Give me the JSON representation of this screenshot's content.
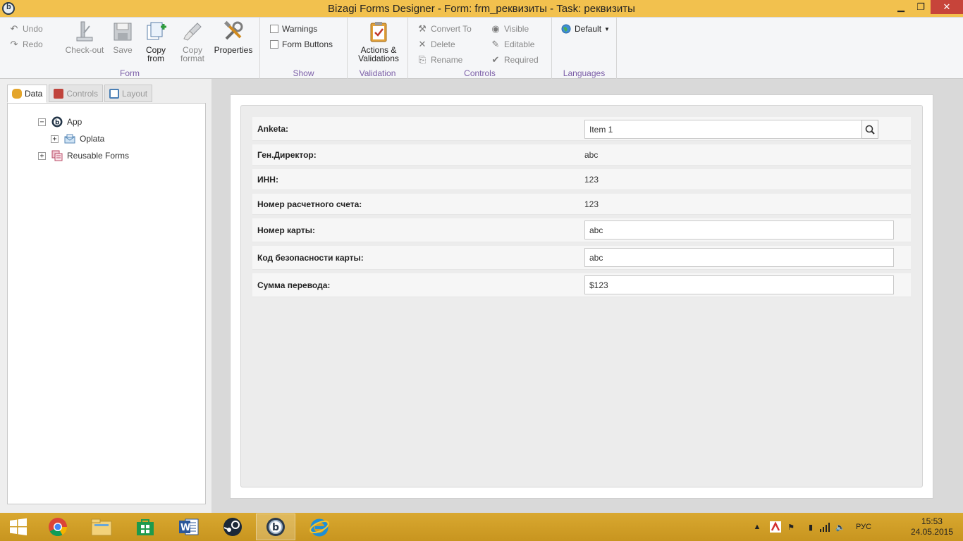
{
  "window": {
    "title": "Bizagi Forms Designer  - Form: frm_реквизиты - Task:  реквизиты",
    "minimize": "▁",
    "maximize": "❐",
    "close": "✕"
  },
  "ribbon": {
    "form_group": {
      "label": "Form",
      "undo": "Undo",
      "redo": "Redo",
      "checkout": "Check-out",
      "save": "Save",
      "copy_from": "Copy from",
      "copy_format": "Copy format",
      "properties": "Properties"
    },
    "show_group": {
      "label": "Show",
      "warnings": "Warnings",
      "form_buttons": "Form Buttons"
    },
    "validation_group": {
      "label": "Validation",
      "actions": "Actions & Validations"
    },
    "controls_group": {
      "label": "Controls",
      "convert_to": "Convert To",
      "delete": "Delete",
      "rename": "Rename",
      "visible": "Visible",
      "editable": "Editable",
      "required": "Required"
    },
    "languages_group": {
      "label": "Languages",
      "default": "Default"
    }
  },
  "left_panel": {
    "tabs": [
      "Data",
      "Controls",
      "Layout"
    ],
    "tree": {
      "app": "App",
      "oplata": "Oplata",
      "reusable_forms": "Reusable Forms"
    }
  },
  "form": {
    "rows": [
      {
        "label": "Anketa:",
        "value": "Item 1",
        "kind": "search"
      },
      {
        "label": "Ген.Директор:",
        "value": "abc",
        "kind": "text"
      },
      {
        "label": "ИНН:",
        "value": "123",
        "kind": "text"
      },
      {
        "label": "Номер расчетного счета:",
        "value": "123",
        "kind": "text"
      },
      {
        "label": "Номер карты:",
        "value": "abc",
        "kind": "input"
      },
      {
        "label": "Код безопасности карты:",
        "value": "abc",
        "kind": "input"
      },
      {
        "label": "Сумма перевода:",
        "value": "$123",
        "kind": "input"
      }
    ]
  },
  "taskbar": {
    "language": "РУС",
    "time": "15:53",
    "date": "24.05.2015"
  },
  "colors": {
    "accent": "#f2c14e",
    "group_label": "#7b5ea7",
    "close": "#c7443a"
  }
}
